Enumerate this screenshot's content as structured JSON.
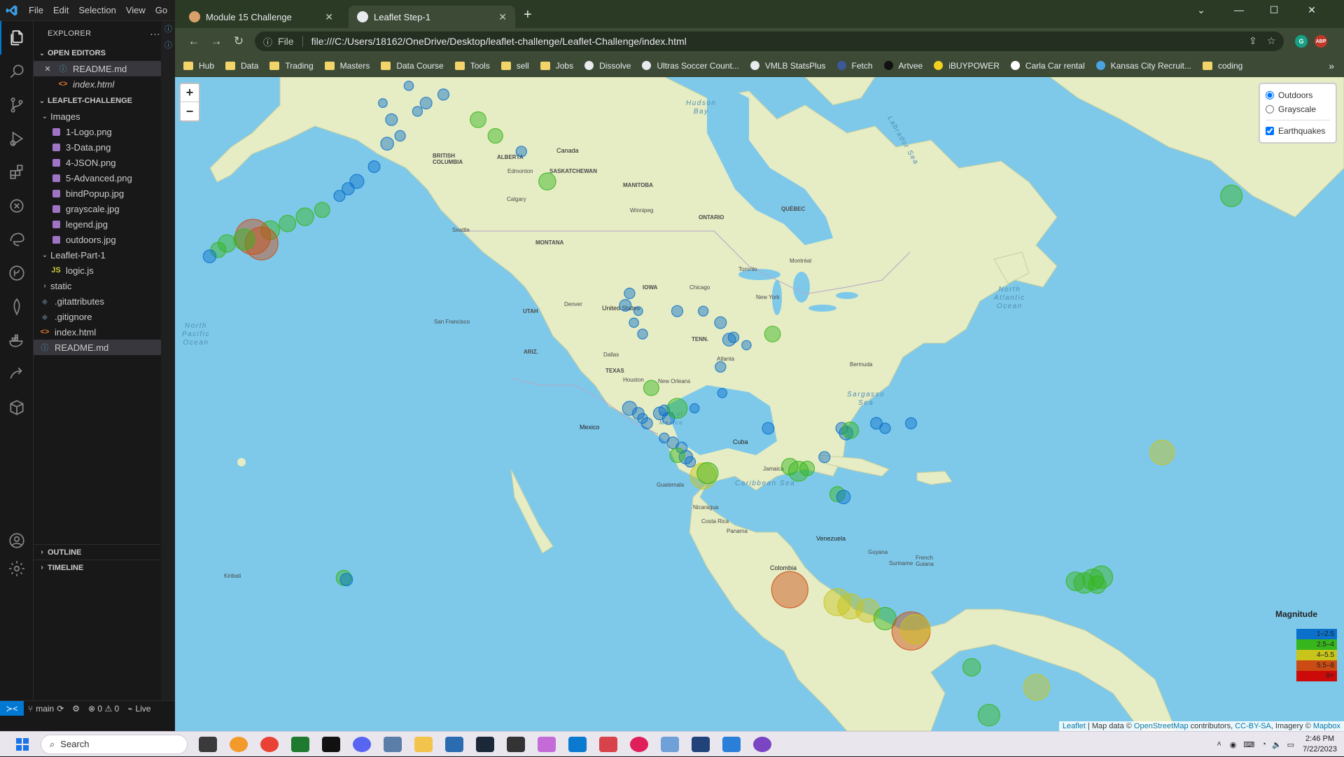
{
  "vscode": {
    "menu": [
      "File",
      "Edit",
      "Selection",
      "View",
      "Go"
    ],
    "explorer_title": "EXPLORER",
    "explorer_more": "···",
    "open_editors_label": "OPEN EDITORS",
    "open_editors": [
      {
        "name": "README.md",
        "icon": "info-icon"
      },
      {
        "name": "index.html",
        "icon": "html-icon"
      }
    ],
    "project_label": "LEAFLET-CHALLENGE",
    "tree": [
      {
        "label": "Images",
        "kind": "folder-open"
      },
      {
        "label": "1-Logo.png",
        "kind": "image"
      },
      {
        "label": "3-Data.png",
        "kind": "image"
      },
      {
        "label": "4-JSON.png",
        "kind": "image"
      },
      {
        "label": "5-Advanced.png",
        "kind": "image"
      },
      {
        "label": "bindPopup.jpg",
        "kind": "image"
      },
      {
        "label": "grayscale.jpg",
        "kind": "image"
      },
      {
        "label": "legend.jpg",
        "kind": "image"
      },
      {
        "label": "outdoors.jpg",
        "kind": "image"
      },
      {
        "label": "Leaflet-Part-1",
        "kind": "folder-open"
      },
      {
        "label": "logic.js",
        "kind": "js"
      },
      {
        "label": "static",
        "kind": "folder-closed"
      },
      {
        "label": ".gitattributes",
        "kind": "git"
      },
      {
        "label": ".gitignore",
        "kind": "git"
      },
      {
        "label": "index.html",
        "kind": "html"
      },
      {
        "label": "README.md",
        "kind": "info"
      }
    ],
    "outline_label": "OUTLINE",
    "timeline_label": "TIMELINE",
    "status": {
      "branch": "main",
      "problems": "⊗ 0 ⚠ 0",
      "live": "Live"
    }
  },
  "chrome": {
    "tabs": [
      {
        "title": "Module 15 Challenge",
        "close": "✕"
      },
      {
        "title": "Leaflet Step-1",
        "close": "✕"
      }
    ],
    "new_tab": "+",
    "address_scheme": "File",
    "address_url": "file:///C:/Users/18162/OneDrive/Desktop/leaflet-challenge/Leaflet-Challenge/index.html",
    "bookmarks": [
      {
        "label": "Hub",
        "icon": "folder"
      },
      {
        "label": "Data",
        "icon": "folder"
      },
      {
        "label": "Trading",
        "icon": "folder"
      },
      {
        "label": "Masters",
        "icon": "folder"
      },
      {
        "label": "Data Course",
        "icon": "folder"
      },
      {
        "label": "Tools",
        "icon": "folder"
      },
      {
        "label": "sell",
        "icon": "folder"
      },
      {
        "label": "Jobs",
        "icon": "folder"
      },
      {
        "label": "Dissolve",
        "icon": "globe"
      },
      {
        "label": "Ultras Soccer Count...",
        "icon": "globe"
      },
      {
        "label": "VMLB StatsPlus",
        "icon": "globe"
      },
      {
        "label": "Fetch",
        "icon": "fetch"
      },
      {
        "label": "Artvee",
        "icon": "artvee"
      },
      {
        "label": "iBUYPOWER",
        "icon": "ibuypower"
      },
      {
        "label": "Carla Car rental",
        "icon": "carla"
      },
      {
        "label": "Kansas City Recruit...",
        "icon": "kc"
      },
      {
        "label": "coding",
        "icon": "folder"
      }
    ]
  },
  "map": {
    "zoom_in": "+",
    "zoom_out": "−",
    "base_layers": [
      {
        "label": "Outdoors",
        "checked": true
      },
      {
        "label": "Grayscale",
        "checked": false
      }
    ],
    "overlays": [
      {
        "label": "Earthquakes",
        "checked": true
      }
    ],
    "legend": {
      "title": "Magnitude",
      "items": [
        {
          "label": "1–2.5",
          "color": "#0a70c9"
        },
        {
          "label": "2.5–4",
          "color": "#36b51c"
        },
        {
          "label": "4–5.5",
          "color": "#c8c41a"
        },
        {
          "label": "5.5–8",
          "color": "#cc4b14"
        },
        {
          "label": "8+",
          "color": "#cc0a0a"
        }
      ]
    },
    "attribution": {
      "leaflet": "Leaflet",
      "sep": " | Map data © ",
      "osm": "OpenStreetMap",
      "contrib": " contributors, ",
      "license": "CC-BY-SA",
      "imagery": ", Imagery © ",
      "mapbox": "Mapbox"
    },
    "labels": {
      "canada": "Canada",
      "united_states": "United States",
      "mexico": "Mexico",
      "cuba": "Cuba",
      "venezuela": "Venezuela",
      "colombia": "Colombia",
      "hudson_bay": "Hudson\nBay",
      "labrador_sea": "Labrador Sea",
      "north_pacific": "North\nPacific\nOcean",
      "north_atlantic": "North\nAtlantic\nOcean",
      "sargasso": "Sargasso\nSea",
      "caribbean": "Caribbean Sea",
      "gulf_mexico": "Gulf of\nMexico",
      "bermuda": "Bermuda",
      "jamaica": "Jamaica",
      "guatemala": "Guatemala",
      "nicaragua": "Nicaragua",
      "costa_rica": "Costa Rica",
      "panama": "Panama",
      "guyana": "Guyana",
      "suriname": "Suriname",
      "french_guiana": "French\nGuiana",
      "kiribati": "Kiribati",
      "british_columbia": "BRITISH\nCOLUMBIA",
      "alberta": "ALBERTA",
      "saskatchewan": "SASKATCHEWAN",
      "manitoba": "MANITOBA",
      "ontario": "ONTARIO",
      "quebec": "QUÉBEC",
      "edmonton": "Edmonton",
      "calgary": "Calgary",
      "winnipeg": "Winnipeg",
      "montana": "MONTANA",
      "texas": "TEXAS",
      "utah": "UTAH",
      "ariz": "ARIZ.",
      "iowa": "IOWA",
      "tenn": "TENN.",
      "bermuda_tri": "",
      "new_orleans": "New Orleans",
      "dallas": "Dallas",
      "houston": "Houston",
      "san_francisco": "San Francisco",
      "chicago": "Chicago",
      "new_york": "New York",
      "toronto": "Toronto",
      "montreal": "Montréal",
      "atlanta": "Atlanta",
      "denver": "Denver",
      "seattle": "Seattle"
    },
    "quakes": [
      {
        "lon": -150,
        "lat": 61,
        "mag": 2.0
      },
      {
        "lon": -149,
        "lat": 60,
        "mag": 1.8
      },
      {
        "lon": -151,
        "lat": 62,
        "mag": 1.5
      },
      {
        "lon": -150.5,
        "lat": 59.5,
        "mag": 2.2
      },
      {
        "lon": -152,
        "lat": 58,
        "mag": 2.0
      },
      {
        "lon": -154,
        "lat": 57,
        "mag": 2.4
      },
      {
        "lon": -155,
        "lat": 56.5,
        "mag": 2.1
      },
      {
        "lon": -156,
        "lat": 56,
        "mag": 1.9
      },
      {
        "lon": -158,
        "lat": 55,
        "mag": 2.6
      },
      {
        "lon": -160,
        "lat": 54.5,
        "mag": 3.0
      },
      {
        "lon": -162,
        "lat": 54,
        "mag": 2.8
      },
      {
        "lon": -164,
        "lat": 53.5,
        "mag": 3.2
      },
      {
        "lon": -166,
        "lat": 53,
        "mag": 6.0
      },
      {
        "lon": -165,
        "lat": 52.5,
        "mag": 5.6
      },
      {
        "lon": -167,
        "lat": 52.8,
        "mag": 3.6
      },
      {
        "lon": -169,
        "lat": 52.5,
        "mag": 3.0
      },
      {
        "lon": -170,
        "lat": 52,
        "mag": 2.6
      },
      {
        "lon": -171,
        "lat": 51.5,
        "mag": 2.2
      },
      {
        "lon": -147,
        "lat": 61.5,
        "mag": 1.7
      },
      {
        "lon": -146,
        "lat": 62,
        "mag": 2.0
      },
      {
        "lon": -148,
        "lat": 63,
        "mag": 1.6
      },
      {
        "lon": -144,
        "lat": 62.5,
        "mag": 1.9
      },
      {
        "lon": -140,
        "lat": 61,
        "mag": 2.7
      },
      {
        "lon": -138,
        "lat": 60,
        "mag": 2.5
      },
      {
        "lon": -135,
        "lat": 59,
        "mag": 1.8
      },
      {
        "lon": -132,
        "lat": 57,
        "mag": 2.9
      },
      {
        "lon": -122.5,
        "lat": 48.5,
        "mag": 1.8
      },
      {
        "lon": -123,
        "lat": 47.5,
        "mag": 2.0
      },
      {
        "lon": -122,
        "lat": 46,
        "mag": 1.6
      },
      {
        "lon": -121.5,
        "lat": 47,
        "mag": 1.5
      },
      {
        "lon": -121,
        "lat": 45,
        "mag": 1.7
      },
      {
        "lon": -117,
        "lat": 47,
        "mag": 1.9
      },
      {
        "lon": -114,
        "lat": 47,
        "mag": 1.7
      },
      {
        "lon": -112,
        "lat": 46,
        "mag": 2.0
      },
      {
        "lon": -111,
        "lat": 44.5,
        "mag": 2.2
      },
      {
        "lon": -110.5,
        "lat": 44.7,
        "mag": 1.8
      },
      {
        "lon": -109,
        "lat": 44,
        "mag": 1.6
      },
      {
        "lon": -106,
        "lat": 45,
        "mag": 2.7
      },
      {
        "lon": -112,
        "lat": 42,
        "mag": 1.8
      },
      {
        "lon": -111.8,
        "lat": 39.5,
        "mag": 1.6
      },
      {
        "lon": -120,
        "lat": 40,
        "mag": 2.6
      },
      {
        "lon": -122.5,
        "lat": 38,
        "mag": 2.4
      },
      {
        "lon": -121.5,
        "lat": 37.5,
        "mag": 2.0
      },
      {
        "lon": -121,
        "lat": 37,
        "mag": 1.7
      },
      {
        "lon": -120.5,
        "lat": 36.5,
        "mag": 1.9
      },
      {
        "lon": -119,
        "lat": 37.5,
        "mag": 2.2
      },
      {
        "lon": -118.5,
        "lat": 37.8,
        "mag": 1.8
      },
      {
        "lon": -118,
        "lat": 37,
        "mag": 2.1
      },
      {
        "lon": -117,
        "lat": 38,
        "mag": 3.4
      },
      {
        "lon": -115,
        "lat": 38,
        "mag": 1.6
      },
      {
        "lon": -118.5,
        "lat": 35,
        "mag": 1.7
      },
      {
        "lon": -117.5,
        "lat": 34.5,
        "mag": 2.0
      },
      {
        "lon": -116.5,
        "lat": 34,
        "mag": 1.9
      },
      {
        "lon": -116,
        "lat": 33,
        "mag": 2.3
      },
      {
        "lon": -115.5,
        "lat": 32.5,
        "mag": 1.8
      },
      {
        "lon": -117,
        "lat": 33.2,
        "mag": 2.5
      },
      {
        "lon": -114,
        "lat": 31,
        "mag": 4.4
      },
      {
        "lon": -113.5,
        "lat": 31.3,
        "mag": 3.6
      },
      {
        "lon": -104,
        "lat": 32,
        "mag": 2.8
      },
      {
        "lon": -103,
        "lat": 31.5,
        "mag": 3.4
      },
      {
        "lon": -102,
        "lat": 31.8,
        "mag": 2.5
      },
      {
        "lon": -100,
        "lat": 33,
        "mag": 1.9
      },
      {
        "lon": -98,
        "lat": 36,
        "mag": 2.0
      },
      {
        "lon": -97.5,
        "lat": 35.5,
        "mag": 2.3
      },
      {
        "lon": -97,
        "lat": 35.8,
        "mag": 2.8
      },
      {
        "lon": -98.5,
        "lat": 29,
        "mag": 2.6
      },
      {
        "lon": -97.8,
        "lat": 28.7,
        "mag": 2.3
      },
      {
        "lon": -94,
        "lat": 36.5,
        "mag": 2.0
      },
      {
        "lon": -93,
        "lat": 36,
        "mag": 1.8
      },
      {
        "lon": -90,
        "lat": 36.5,
        "mag": 1.9
      },
      {
        "lon": -106.5,
        "lat": 36,
        "mag": 2.0
      },
      {
        "lon": -155.5,
        "lat": 19.4,
        "mag": 2.6
      },
      {
        "lon": -155.2,
        "lat": 19.2,
        "mag": 2.1
      },
      {
        "lon": -104,
        "lat": 18,
        "mag": 6.2
      },
      {
        "lon": -98.5,
        "lat": 16.5,
        "mag": 4.6
      },
      {
        "lon": -97,
        "lat": 16,
        "mag": 4.3
      },
      {
        "lon": -95,
        "lat": 15.5,
        "mag": 4.0
      },
      {
        "lon": -93,
        "lat": 14.5,
        "mag": 3.8
      },
      {
        "lon": -90,
        "lat": 13,
        "mag": 6.5
      },
      {
        "lon": -89.5,
        "lat": 13.2,
        "mag": 5.0
      },
      {
        "lon": -83,
        "lat": 8.5,
        "mag": 3.0
      },
      {
        "lon": -71,
        "lat": 19,
        "mag": 3.2
      },
      {
        "lon": -70,
        "lat": 18.8,
        "mag": 3.5
      },
      {
        "lon": -69,
        "lat": 19.2,
        "mag": 3.6
      },
      {
        "lon": -68,
        "lat": 19.5,
        "mag": 3.8
      },
      {
        "lon": -68.5,
        "lat": 18.6,
        "mag": 3.0
      },
      {
        "lon": -75.5,
        "lat": 6,
        "mag": 4.4
      },
      {
        "lon": -81,
        "lat": 2.5,
        "mag": 3.7
      },
      {
        "lon": -61,
        "lat": 33.5,
        "mag": 4.2
      },
      {
        "lon": -53,
        "lat": 56,
        "mag": 3.7
      }
    ]
  },
  "taskbar": {
    "search": "Search",
    "time": "2:46 PM",
    "date": "7/22/2023"
  }
}
